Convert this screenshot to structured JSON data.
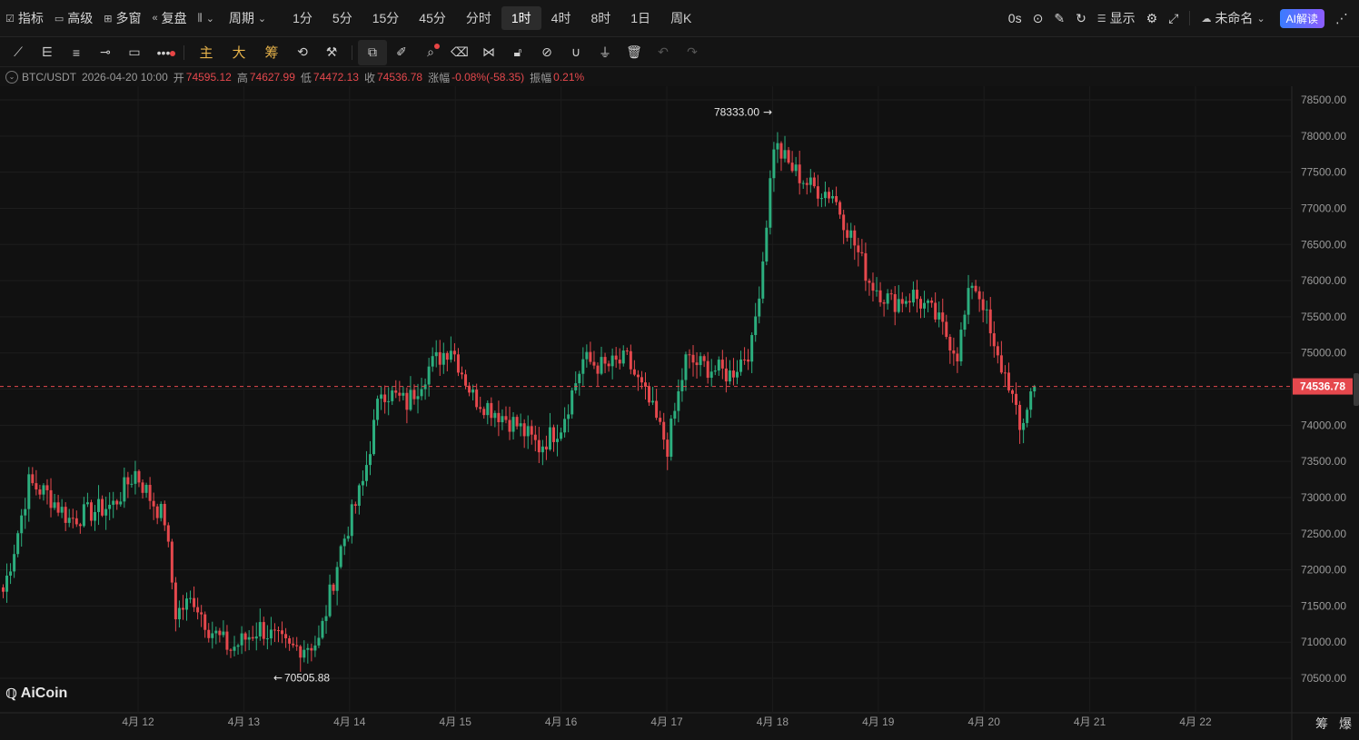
{
  "topbar": {
    "indicators": "指标",
    "advanced": "高级",
    "multi_window": "多窗",
    "replay": "复盘",
    "period_label": "周期",
    "periods": [
      "1分",
      "5分",
      "15分",
      "45分",
      "分时",
      "1时",
      "4时",
      "8时",
      "1日",
      "周K"
    ],
    "active_period": "1时",
    "countdown": "0s",
    "display": "显示",
    "layout_name": "未命名",
    "ai_label": "AI解读"
  },
  "toolbar": {
    "gold_tools": [
      "主",
      "大",
      "筹"
    ]
  },
  "info": {
    "symbol": "BTC/USDT",
    "datetime": "2026-04-20 10:00",
    "open_label": "开",
    "open": "74595.12",
    "high_label": "高",
    "high": "74627.99",
    "low_label": "低",
    "low": "74472.13",
    "close_label": "收",
    "close": "74536.78",
    "change_label": "涨幅",
    "change": "-0.08%(-58.35)",
    "amplitude_label": "振幅",
    "amplitude": "0.21%"
  },
  "chart_data": {
    "type": "candlestick",
    "symbol": "BTC/USDT",
    "interval": "1h",
    "y_ticks": [
      "78500.00",
      "78000.00",
      "77500.00",
      "77000.00",
      "76500.00",
      "76000.00",
      "75500.00",
      "75000.00",
      "74500.00",
      "74000.00",
      "73500.00",
      "73000.00",
      "72500.00",
      "72000.00",
      "71500.00",
      "71000.00",
      "70500.00"
    ],
    "ylim": [
      70200,
      78700
    ],
    "x_ticks": [
      "4月 12",
      "4月 13",
      "4月 14",
      "4月 15",
      "4月 16",
      "4月 17",
      "4月 18",
      "4月 19",
      "4月 20",
      "4月 21",
      "4月 22"
    ],
    "current_price": "74536.78",
    "max_marker": "78333.00",
    "min_marker": "70505.88",
    "trend_waypoints": [
      [
        0,
        71700
      ],
      [
        3,
        72300
      ],
      [
        7,
        73200
      ],
      [
        12,
        73050
      ],
      [
        18,
        72700
      ],
      [
        24,
        72800
      ],
      [
        30,
        72900
      ],
      [
        36,
        73350
      ],
      [
        40,
        73000
      ],
      [
        44,
        72700
      ],
      [
        47,
        71400
      ],
      [
        52,
        71600
      ],
      [
        56,
        71200
      ],
      [
        62,
        70900
      ],
      [
        70,
        71200
      ],
      [
        78,
        70900
      ],
      [
        86,
        71000
      ],
      [
        92,
        72300
      ],
      [
        98,
        73200
      ],
      [
        103,
        74500
      ],
      [
        110,
        74300
      ],
      [
        116,
        74800
      ],
      [
        122,
        75100
      ],
      [
        128,
        74400
      ],
      [
        134,
        74200
      ],
      [
        140,
        74000
      ],
      [
        146,
        73700
      ],
      [
        152,
        74000
      ],
      [
        158,
        74900
      ],
      [
        164,
        74800
      ],
      [
        170,
        74900
      ],
      [
        176,
        74300
      ],
      [
        181,
        73700
      ],
      [
        186,
        74900
      ],
      [
        192,
        74800
      ],
      [
        198,
        74700
      ],
      [
        204,
        75100
      ],
      [
        207,
        76300
      ],
      [
        210,
        77900
      ],
      [
        214,
        77600
      ],
      [
        220,
        77300
      ],
      [
        226,
        77200
      ],
      [
        232,
        76500
      ],
      [
        236,
        76000
      ],
      [
        242,
        75700
      ],
      [
        248,
        75800
      ],
      [
        254,
        75500
      ],
      [
        260,
        75000
      ],
      [
        264,
        76000
      ],
      [
        267,
        75700
      ],
      [
        270,
        75000
      ],
      [
        274,
        74600
      ],
      [
        277,
        73900
      ],
      [
        280,
        74450
      ],
      [
        281,
        74537
      ]
    ],
    "colors": {
      "up": "#2cae7e",
      "down": "#e5484d",
      "price_tag": "#e5484d"
    }
  }
}
